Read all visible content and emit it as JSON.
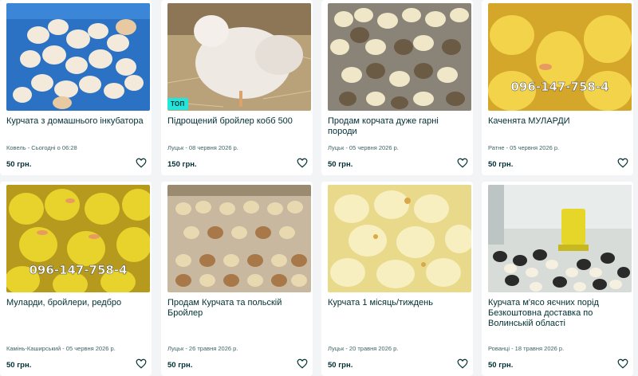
{
  "listings": [
    {
      "title": "Курчата з домашнього інкубатора",
      "meta": "Ковель - Сьогодні о 06:28",
      "price": "50 грн."
    },
    {
      "title": "Підрощений бройлер кобб 500",
      "meta": "Луцьк - 08 червня 2026 р.",
      "price": "150 грн.",
      "badge": "ТОП"
    },
    {
      "title": "Продам корчата дуже гарні породи",
      "meta": "Луцьк - 05 червня 2026 р.",
      "price": "50 грн."
    },
    {
      "title": "Каченята МУЛАРДИ",
      "meta": "Ратне - 05 червня 2026 р.",
      "price": "50 грн.",
      "phone_overlay": "096-147-758-4"
    },
    {
      "title": "Мулaрди, бройлери, редбро",
      "meta": "Камінь-Каширський - 05 червня 2026 р.",
      "price": "50 грн.",
      "phone_overlay": "096-147-758-4"
    },
    {
      "title": "Продам Курчата та польскій Бройлер",
      "meta": "Луцьк - 26 травня 2026 р.",
      "price": "50 грн."
    },
    {
      "title": "Курчата 1 місяць/тиждень",
      "meta": "Луцьк - 20 травня 2026 р.",
      "price": "50 грн."
    },
    {
      "title": "Курчата м'ясо яєчних порід Безкоштовна доставка по Волинській області",
      "meta": "Рованці - 18 травня 2026 р.",
      "price": "50 грн."
    }
  ],
  "icons": {
    "favorite": "heart-outline-icon"
  },
  "colors": {
    "badge": "#23e5db",
    "text": "#002f34",
    "meta": "#406367",
    "background": "#f2f4f5"
  }
}
